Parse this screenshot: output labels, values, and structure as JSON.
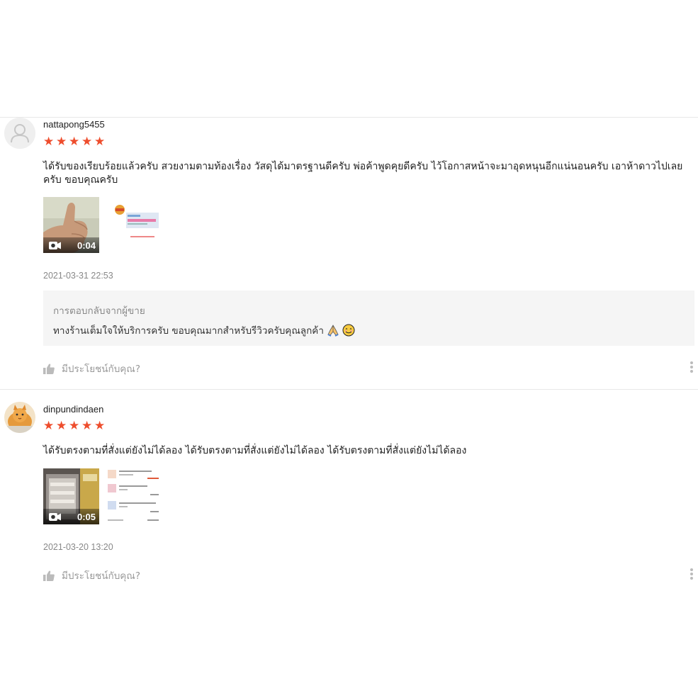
{
  "reviews": [
    {
      "username": "nattapong5455",
      "rating": 5,
      "comment": "ได้รับของเรียบร้อยแล้วครับ สวยงามตามท้องเรื่อง วัสดุได้มาตรฐานดีครับ พ่อค้าพูดคุยดีครับ ไว้โอกาสหน้าจะมาอุดหนุนอีกแน่นอนครับ เอาห้าดาวไปเลยครับ ขอบคุณครับ",
      "video_duration": "0:04",
      "date": "2021-03-31 22:53",
      "seller_reply": {
        "title": "การตอบกลับจากผู้ขาย",
        "text": "ทางร้านเต็มใจให้บริการครับ ขอบคุณมากสำหรับรีวิวครับคุณลูกค้า",
        "emojis": [
          "folded-hands-emoji",
          "smiling-face-emoji"
        ]
      },
      "helpful_label": "มีประโยชน์กับคุณ?"
    },
    {
      "username": "dinpundindaen",
      "rating": 5,
      "comment": "ได้รับตรงตามที่สั่งแต่ยังไม่ได้ลอง ได้รับตรงตามที่สั่งแต่ยังไม่ได้ลอง ได้รับตรงตามที่สั่งแต่ยังไม่ได้ลอง",
      "video_duration": "0:05",
      "date": "2021-03-20 13:20",
      "helpful_label": "มีประโยชน์กับคุณ?"
    }
  ],
  "colors": {
    "star": "#ee4d2d",
    "muted_text": "#888888",
    "reply_bg": "#f5f5f5"
  },
  "icons": [
    "user-avatar-icon",
    "star-icon",
    "video-camera-icon",
    "thumbs-up-icon",
    "more-options-icon"
  ]
}
